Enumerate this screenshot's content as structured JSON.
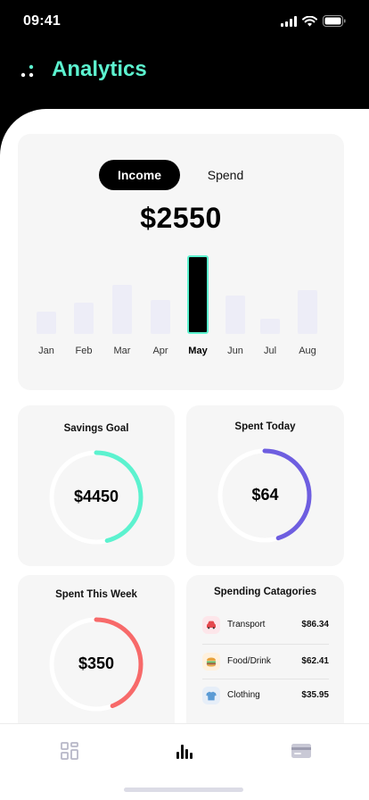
{
  "status": {
    "time": "09:41"
  },
  "header": {
    "title": "Analytics"
  },
  "toggle": {
    "income": "Income",
    "spend": "Spend"
  },
  "summary": {
    "amount": "$2550"
  },
  "months": [
    {
      "label": "Jan",
      "value": 0.28,
      "active": false
    },
    {
      "label": "Feb",
      "value": 0.4,
      "active": false
    },
    {
      "label": "Mar",
      "value": 0.62,
      "active": false
    },
    {
      "label": "Apr",
      "value": 0.43,
      "active": false
    },
    {
      "label": "May",
      "value": 1.0,
      "active": true
    },
    {
      "label": "Jun",
      "value": 0.49,
      "active": false
    },
    {
      "label": "Jul",
      "value": 0.19,
      "active": false
    },
    {
      "label": "Aug",
      "value": 0.56,
      "active": false
    }
  ],
  "savings": {
    "title": "Savings Goal",
    "value": "$4450",
    "progress": 0.46,
    "color": "#5cf2cf"
  },
  "today": {
    "title": "Spent Today",
    "value": "$64",
    "progress": 0.45,
    "color": "#6e5ee0"
  },
  "week": {
    "title": "Spent This Week",
    "value": "$350",
    "progress": 0.44,
    "color": "#f76a6a"
  },
  "categories": {
    "title": "Spending Catagories",
    "items": [
      {
        "name": "Transport",
        "amount": "$86.34",
        "icon": "car-icon",
        "color": "#fde6ea"
      },
      {
        "name": "Food/Drink",
        "amount": "$62.41",
        "icon": "burger-icon",
        "color": "#fff1dd"
      },
      {
        "name": "Clothing",
        "amount": "$35.95",
        "icon": "shirt-icon",
        "color": "#e6eef8"
      }
    ]
  },
  "tabbar": {
    "items": [
      "dashboard-icon",
      "analytics-icon",
      "wallet-icon"
    ]
  }
}
